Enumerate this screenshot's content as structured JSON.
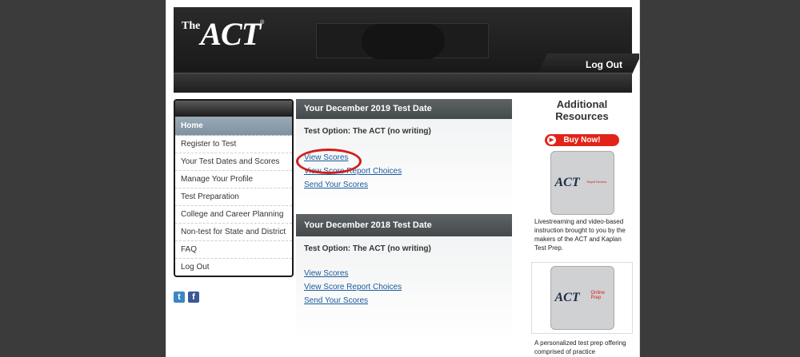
{
  "header": {
    "logo_the": "The",
    "logo_act": "ACT",
    "logo_reg": "®",
    "logout": "Log Out"
  },
  "nav": {
    "items": [
      "Home",
      "Register to Test",
      "Your Test Dates and Scores",
      "Manage Your Profile",
      "Test Preparation",
      "College and Career Planning",
      "Non-test for State and District",
      "FAQ",
      "Log Out"
    ]
  },
  "social": {
    "twitter": "t",
    "facebook": "f"
  },
  "panels": [
    {
      "title": "Your December 2019 Test Date",
      "option": "Test Option: The ACT (no writing)",
      "links": [
        "View Scores",
        "View Score Report Choices",
        "Send Your Scores"
      ]
    },
    {
      "title": "Your December 2018 Test Date",
      "option": "Test Option: The ACT (no writing)",
      "links": [
        "View Scores",
        "View Score Report Choices",
        "Send Your Scores"
      ]
    }
  ],
  "resources": {
    "title": "Additional Resources",
    "buy": "Buy Now!",
    "tile1": {
      "word": "ACT",
      "sub": "Rapid Review"
    },
    "desc1": "Livestreaming and video-based instruction brought to you by the makers of the ACT and Kaplan Test Prep.",
    "tile2": {
      "word": "ACT",
      "sub": "Online Prep"
    },
    "desc2": "A personalized test prep offering comprised of practice"
  },
  "colors": {
    "accent_red": "#d11e1e",
    "link_blue": "#1a5a9c"
  }
}
